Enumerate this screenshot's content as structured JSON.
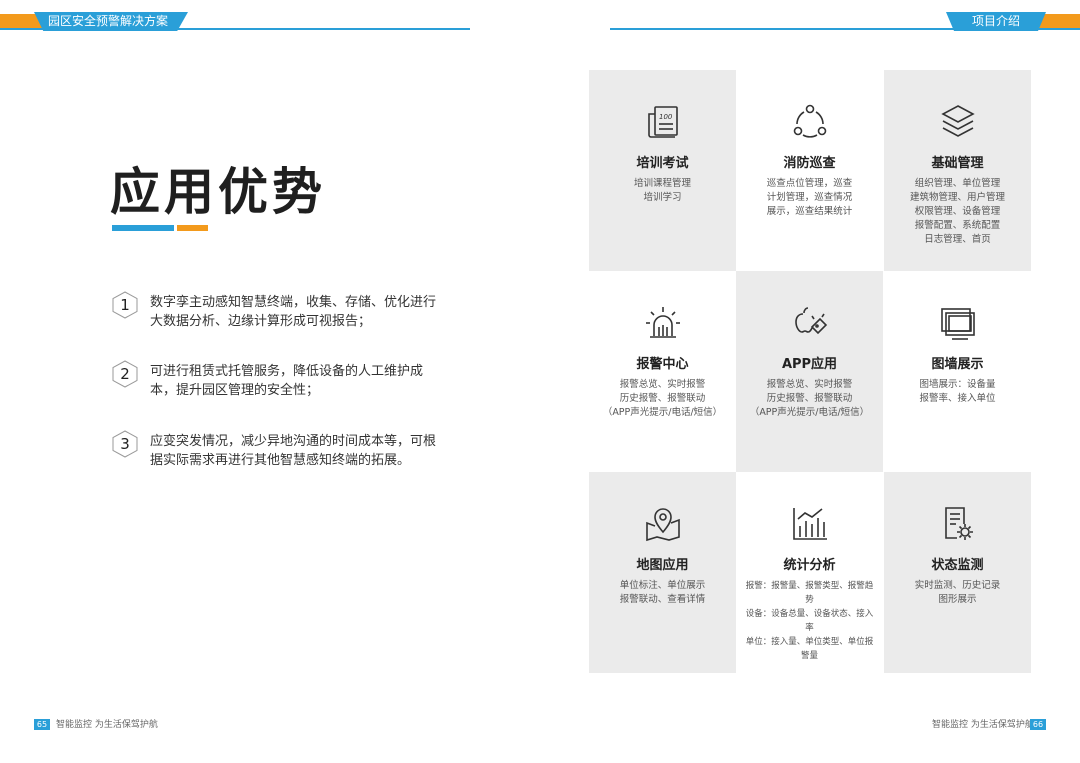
{
  "header": {
    "left_tab": "园区安全预警解决方案",
    "right_tab": "项目介绍"
  },
  "title": "应用优势",
  "points": [
    {
      "num": "1",
      "text": "数字孪主动感知智慧终端，收集、存储、优化进行大数据分析、边缘计算形成可视报告；"
    },
    {
      "num": "2",
      "text": "可进行租赁式托管服务，降低设备的人工维护成本，提升园区管理的安全性；"
    },
    {
      "num": "3",
      "text": "应变突发情况，减少异地沟通的时间成本等，可根据实际需求再进行其他智慧感知终端的拓展。"
    }
  ],
  "cells": [
    {
      "icon": "exam-icon",
      "title": "培训考试",
      "desc": [
        "培训课程管理",
        "培训学习"
      ]
    },
    {
      "icon": "patrol-icon",
      "title": "消防巡查",
      "desc": [
        "巡查点位管理，巡查",
        "计划管理，巡查情况",
        "展示，巡查结果统计"
      ]
    },
    {
      "icon": "layers-icon",
      "title": "基础管理",
      "desc": [
        "组织管理、单位管理",
        "建筑物管理、用户管理",
        "权限管理、设备管理",
        "报警配置、系统配置",
        "日志管理、首页"
      ]
    },
    {
      "icon": "alarm-icon",
      "title": "报警中心",
      "desc": [
        "报警总览、实时报警",
        "历史报警、报警联动",
        "（APP声光提示/电话/短信）"
      ]
    },
    {
      "icon": "app-icon",
      "title": "APP应用",
      "desc": [
        "报警总览、实时报警",
        "历史报警、报警联动",
        "（APP声光提示/电话/短信）"
      ]
    },
    {
      "icon": "monitor-icon",
      "title": "图墙展示",
      "desc": [
        "图墙展示：设备量",
        "报警率、接入单位"
      ]
    },
    {
      "icon": "map-pin-icon",
      "title": "地图应用",
      "desc": [
        "单位标注、单位展示",
        "报警联动、查看详情"
      ]
    },
    {
      "icon": "chart-icon",
      "title": "统计分析",
      "desc": [
        "报警：报警量、报警类型、报警趋势",
        "设备：设备总量、设备状态、接入率",
        "单位：接入量、单位类型、单位报警量"
      ]
    },
    {
      "icon": "doc-gear-icon",
      "title": "状态监测",
      "desc": [
        "实时监测、历史记录",
        "图形展示"
      ]
    }
  ],
  "footer": {
    "left_page": "65",
    "left_text": "智能监控  为生活保驾护航",
    "right_text": "智能监控  为生活保驾护航",
    "right_page": "66"
  },
  "colors": {
    "accent_blue": "#2a9fd8",
    "accent_orange": "#f39a1c",
    "cell_gray": "#ebebeb"
  }
}
